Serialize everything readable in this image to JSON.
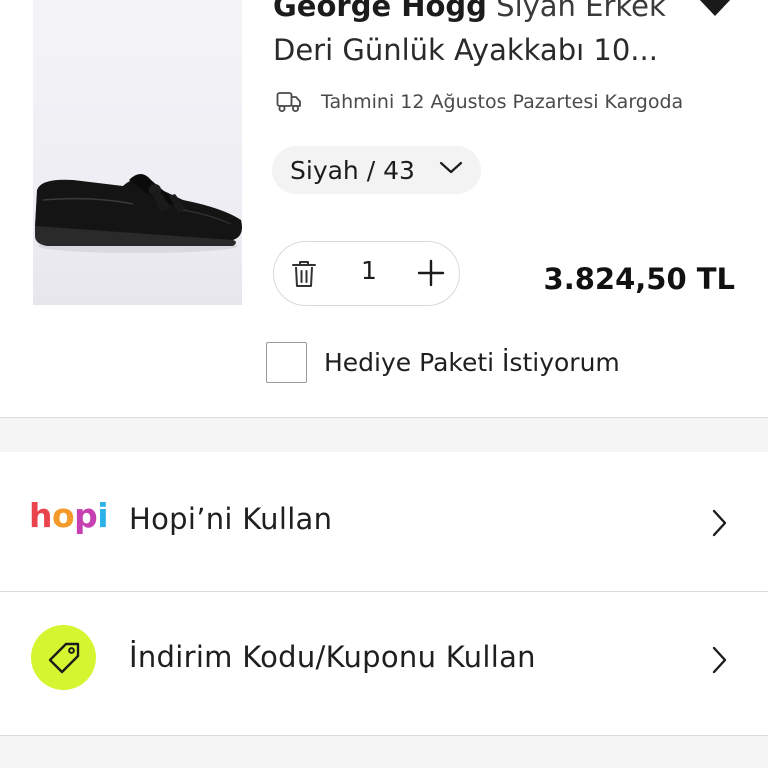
{
  "product": {
    "brand": "George Hogg",
    "name_line1": "Siyah Erkek",
    "name_line2": "Deri Günlük Ayakkabı 10...",
    "delivery_text": "Tahmini 12 Ağustos Pazartesi Kargoda",
    "variant": "Siyah / 43",
    "quantity": "1",
    "price": "3.824,50 TL",
    "gift_label": "Hediye Paketi İstiyorum"
  },
  "options": {
    "hopi_logo": {
      "h": "h",
      "o": "o",
      "p": "p",
      "i": "i"
    },
    "hopi_label": "Hopi’ni Kullan",
    "coupon_label": "İndirim Kodu/Kuponu Kullan"
  },
  "colors": {
    "accent_lime": "#d6f531",
    "hopi_h": "#e9434e",
    "hopi_o": "#f39a2b",
    "hopi_p": "#c83fb1",
    "hopi_i": "#2bb2e8"
  },
  "icons": {
    "delivery": "truck-icon",
    "variant_dropdown": "chevron-down-icon",
    "remove": "trash-icon",
    "increase": "plus-icon",
    "favorite": "heart-icon",
    "coupon": "tag-icon",
    "navigate": "chevron-right-icon"
  }
}
